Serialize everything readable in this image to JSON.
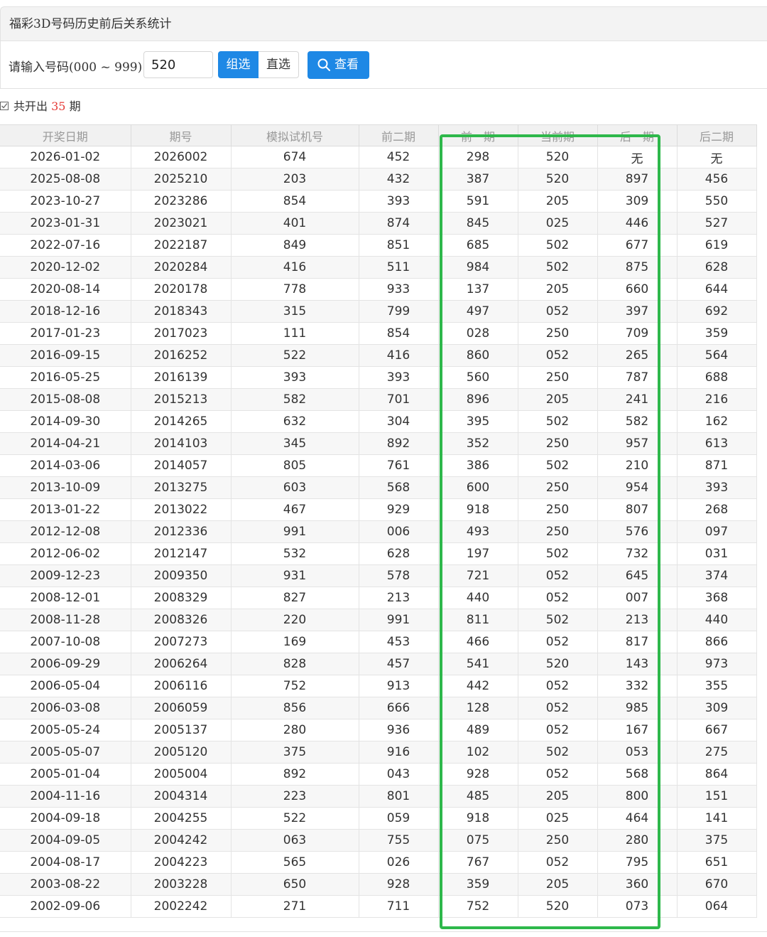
{
  "panel": {
    "title": "福彩3D号码历史前后关系统计"
  },
  "search": {
    "label": "请输入号码(000 ~ 999):",
    "value": "520",
    "mode_group": "组选",
    "mode_direct": "直选",
    "active_mode": "组选",
    "view_button": "查看"
  },
  "summary": {
    "prefix": "共开出",
    "count": "35",
    "suffix": "期"
  },
  "table": {
    "columns": [
      "开奖日期",
      "期号",
      "模拟试机号",
      "前二期",
      "前一期",
      "当前期",
      "后一期",
      "后二期"
    ],
    "rows": [
      [
        "2026-01-02",
        "2026002",
        "674",
        "452",
        "298",
        "520",
        "无",
        "无"
      ],
      [
        "2025-08-08",
        "2025210",
        "203",
        "432",
        "387",
        "520",
        "897",
        "456"
      ],
      [
        "2023-10-27",
        "2023286",
        "854",
        "393",
        "591",
        "205",
        "309",
        "550"
      ],
      [
        "2023-01-31",
        "2023021",
        "401",
        "874",
        "845",
        "025",
        "446",
        "527"
      ],
      [
        "2022-07-16",
        "2022187",
        "849",
        "851",
        "685",
        "502",
        "677",
        "619"
      ],
      [
        "2020-12-02",
        "2020284",
        "416",
        "511",
        "984",
        "502",
        "875",
        "628"
      ],
      [
        "2020-08-14",
        "2020178",
        "778",
        "933",
        "137",
        "205",
        "660",
        "644"
      ],
      [
        "2018-12-16",
        "2018343",
        "315",
        "799",
        "497",
        "052",
        "397",
        "692"
      ],
      [
        "2017-01-23",
        "2017023",
        "111",
        "854",
        "028",
        "250",
        "709",
        "359"
      ],
      [
        "2016-09-15",
        "2016252",
        "522",
        "416",
        "860",
        "052",
        "265",
        "564"
      ],
      [
        "2016-05-25",
        "2016139",
        "393",
        "393",
        "560",
        "250",
        "787",
        "688"
      ],
      [
        "2015-08-08",
        "2015213",
        "582",
        "701",
        "896",
        "205",
        "241",
        "216"
      ],
      [
        "2014-09-30",
        "2014265",
        "632",
        "304",
        "395",
        "502",
        "582",
        "162"
      ],
      [
        "2014-04-21",
        "2014103",
        "345",
        "892",
        "352",
        "250",
        "957",
        "613"
      ],
      [
        "2014-03-06",
        "2014057",
        "805",
        "761",
        "386",
        "502",
        "210",
        "871"
      ],
      [
        "2013-10-09",
        "2013275",
        "603",
        "568",
        "600",
        "250",
        "954",
        "393"
      ],
      [
        "2013-01-22",
        "2013022",
        "467",
        "929",
        "918",
        "250",
        "807",
        "268"
      ],
      [
        "2012-12-08",
        "2012336",
        "991",
        "006",
        "493",
        "250",
        "576",
        "097"
      ],
      [
        "2012-06-02",
        "2012147",
        "532",
        "628",
        "197",
        "502",
        "732",
        "031"
      ],
      [
        "2009-12-23",
        "2009350",
        "931",
        "578",
        "721",
        "052",
        "645",
        "374"
      ],
      [
        "2008-12-01",
        "2008329",
        "827",
        "213",
        "440",
        "052",
        "007",
        "368"
      ],
      [
        "2008-11-28",
        "2008326",
        "220",
        "991",
        "811",
        "502",
        "213",
        "440"
      ],
      [
        "2007-10-08",
        "2007273",
        "169",
        "453",
        "466",
        "052",
        "817",
        "866"
      ],
      [
        "2006-09-29",
        "2006264",
        "828",
        "457",
        "541",
        "520",
        "143",
        "973"
      ],
      [
        "2006-05-04",
        "2006116",
        "752",
        "913",
        "442",
        "052",
        "332",
        "355"
      ],
      [
        "2006-03-08",
        "2006059",
        "856",
        "666",
        "128",
        "052",
        "985",
        "309"
      ],
      [
        "2005-05-24",
        "2005137",
        "280",
        "936",
        "489",
        "052",
        "167",
        "667"
      ],
      [
        "2005-05-07",
        "2005120",
        "375",
        "916",
        "102",
        "502",
        "053",
        "275"
      ],
      [
        "2005-01-04",
        "2005004",
        "892",
        "043",
        "928",
        "052",
        "568",
        "864"
      ],
      [
        "2004-11-16",
        "2004314",
        "223",
        "801",
        "485",
        "205",
        "800",
        "151"
      ],
      [
        "2004-09-18",
        "2004255",
        "522",
        "059",
        "918",
        "025",
        "464",
        "141"
      ],
      [
        "2004-09-05",
        "2004242",
        "063",
        "755",
        "075",
        "250",
        "280",
        "375"
      ],
      [
        "2004-08-17",
        "2004223",
        "565",
        "026",
        "767",
        "052",
        "795",
        "651"
      ],
      [
        "2003-08-22",
        "2003228",
        "650",
        "928",
        "359",
        "205",
        "360",
        "670"
      ],
      [
        "2002-09-06",
        "2002242",
        "271",
        "711",
        "752",
        "520",
        "073",
        "064"
      ]
    ]
  },
  "colors": {
    "accent": "#1e88e5",
    "highlight": "#2eb84b",
    "count": "#e53935"
  }
}
